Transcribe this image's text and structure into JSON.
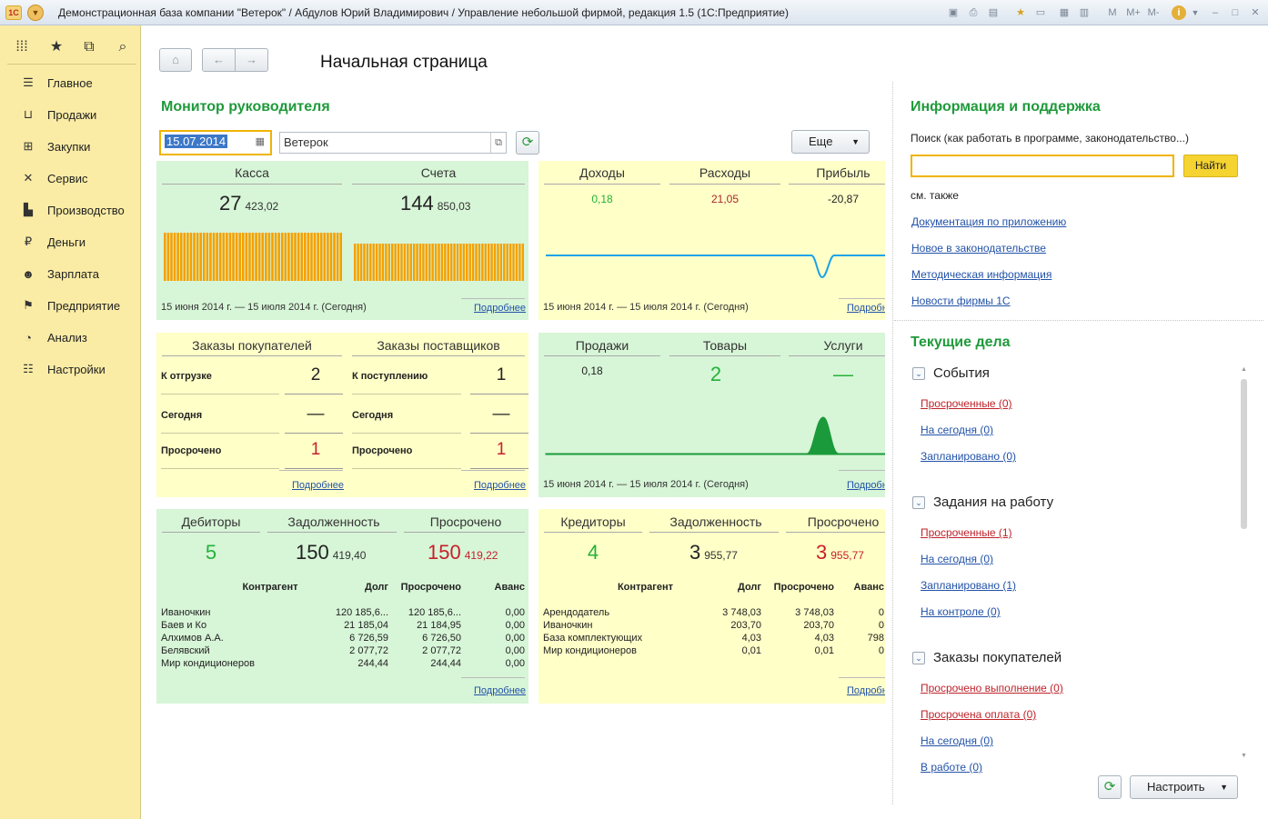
{
  "window": {
    "title": "Демонстрационная база компании \"Ветерок\" / Абдулов Юрий Владимирович / Управление небольшой фирмой, редакция 1.5  (1С:Предприятие)",
    "logo": "1С"
  },
  "toolbar_right": [
    "M",
    "M+",
    "M-",
    "i"
  ],
  "sidebar": {
    "items": [
      {
        "label": "Главное",
        "icon": "menu-icon"
      },
      {
        "label": "Продажи",
        "icon": "basket-icon"
      },
      {
        "label": "Закупки",
        "icon": "cart-icon"
      },
      {
        "label": "Сервис",
        "icon": "tools-icon"
      },
      {
        "label": "Производство",
        "icon": "factory-icon"
      },
      {
        "label": "Деньги",
        "icon": "ruble-icon"
      },
      {
        "label": "Зарплата",
        "icon": "people-icon"
      },
      {
        "label": "Предприятие",
        "icon": "flag-icon"
      },
      {
        "label": "Анализ",
        "icon": "pie-chart-icon"
      },
      {
        "label": "Настройки",
        "icon": "settings-icon"
      }
    ]
  },
  "page": {
    "title": "Начальная страница"
  },
  "monitor": {
    "title": "Монитор руководителя",
    "date": "15.07.2014",
    "company": "Ветерок",
    "more_button": "Еще",
    "period": "15 июня 2014 г. — 15 июля 2014 г. (Сегодня)",
    "more_link": "Подробнее",
    "cash": {
      "label": "Касса",
      "int": "27",
      "frac": "423,02",
      "bars": 55
    },
    "accounts": {
      "label": "Счета",
      "int": "144",
      "frac": "850,03",
      "bars": 55
    },
    "income": {
      "label": "Доходы",
      "value": "0,18"
    },
    "expenses": {
      "label": "Расходы",
      "value": "21,05"
    },
    "profit": {
      "label": "Прибыль",
      "value": "-20,87"
    },
    "orders": {
      "customers_title": "Заказы покупателей",
      "suppliers_title": "Заказы поставщиков",
      "c_rows": [
        {
          "label": "К отгрузке",
          "value": "2"
        },
        {
          "label": "Сегодня",
          "value": "—"
        },
        {
          "label": "Просрочено",
          "value": "1"
        }
      ],
      "s_rows": [
        {
          "label": "К поступлению",
          "value": "1"
        },
        {
          "label": "Сегодня",
          "value": "—"
        },
        {
          "label": "Просрочено",
          "value": "1"
        }
      ]
    },
    "sales": {
      "label": "Продажи",
      "value": "0,18"
    },
    "goods": {
      "label": "Товары",
      "value": "2"
    },
    "services": {
      "label": "Услуги",
      "value": "—"
    },
    "debtors": {
      "label": "Дебиторы",
      "count": "5",
      "debt_label": "Задолженность",
      "debt_int": "150",
      "debt_frac": "419,40",
      "overdue_label": "Просрочено",
      "overdue_int": "150",
      "overdue_frac": "419,22",
      "columns": [
        "Контрагент",
        "Долг",
        "Просрочено",
        "Аванс"
      ],
      "rows": [
        [
          "Иваночкин",
          "120 185,6...",
          "120 185,6...",
          "0,00"
        ],
        [
          "Баев и Ко",
          "21 185,04",
          "21 184,95",
          "0,00"
        ],
        [
          "Алхимов А.А.",
          "6 726,59",
          "6 726,50",
          "0,00"
        ],
        [
          "Белявский",
          "2 077,72",
          "2 077,72",
          "0,00"
        ],
        [
          "Мир кондиционеров",
          "244,44",
          "244,44",
          "0,00"
        ]
      ]
    },
    "creditors": {
      "label": "Кредиторы",
      "count": "4",
      "debt_label": "Задолженность",
      "debt_int": "3",
      "debt_frac": "955,77",
      "overdue_label": "Просрочено",
      "overdue_int": "3",
      "overdue_frac": "955,77",
      "columns": [
        "Контрагент",
        "Долг",
        "Просрочено",
        "Аванс"
      ],
      "rows": [
        [
          "Арендодатель",
          "3 748,03",
          "3 748,03",
          "0"
        ],
        [
          "Иваночкин",
          "203,70",
          "203,70",
          "0"
        ],
        [
          "База комплектующих",
          "4,03",
          "4,03",
          "798"
        ],
        [
          "Мир кондиционеров",
          "0,01",
          "0,01",
          "0"
        ]
      ]
    }
  },
  "info": {
    "title": "Информация и поддержка",
    "search_label": "Поиск (как работать в программе, законодательство...)",
    "search_value": "",
    "find_button": "Найти",
    "see_also": "см. также",
    "links": [
      "Документация по приложению",
      "Новое в законодательстве",
      "Методическая информация",
      "Новости фирмы 1С"
    ]
  },
  "tasks": {
    "title": "Текущие дела",
    "groups": [
      {
        "title": "События",
        "items": [
          {
            "label": "Просроченные (0)",
            "red": true
          },
          {
            "label": "На сегодня (0)",
            "red": false
          },
          {
            "label": "Запланировано (0)",
            "red": false
          }
        ]
      },
      {
        "title": "Задания на работу",
        "items": [
          {
            "label": "Просроченные (1)",
            "red": true
          },
          {
            "label": "На сегодня (0)",
            "red": false
          },
          {
            "label": "Запланировано (1)",
            "red": false
          },
          {
            "label": "На контроле (0)",
            "red": false
          }
        ]
      },
      {
        "title": "Заказы покупателей",
        "items": [
          {
            "label": "Просрочено выполнение (0)",
            "red": true
          },
          {
            "label": "Просрочена оплата (0)",
            "red": true
          },
          {
            "label": "На сегодня (0)",
            "red": false
          },
          {
            "label": "В работе (0)",
            "red": false
          }
        ]
      }
    ],
    "configure_button": "Настроить"
  },
  "colors": {
    "accent_green": "#1f9a3a",
    "panel_green": "#d7f5d7",
    "panel_yellow": "#ffffc8",
    "sidebar": "#fbeca5",
    "bar_orange": "#f5a000",
    "line_blue": "#1aa3e8"
  }
}
